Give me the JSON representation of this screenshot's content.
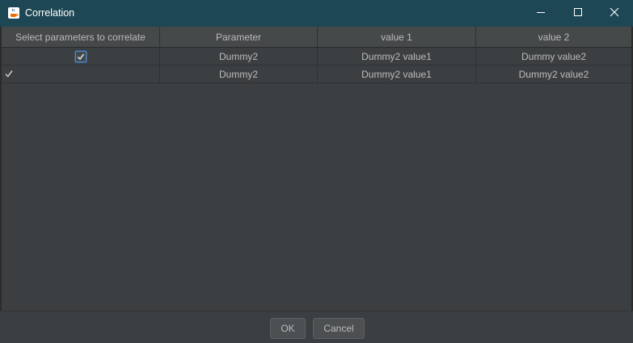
{
  "window": {
    "title": "Correlation",
    "icons": {
      "app": "java-coffee-cup-icon",
      "minimize": "minimize-icon",
      "maximize": "maximize-icon",
      "close": "close-icon"
    }
  },
  "table": {
    "columns": [
      "Select parameters to correlate",
      "Parameter",
      "value 1",
      "value 2"
    ],
    "rows": [
      {
        "selected": true,
        "parameter": "Dummy2",
        "value1": "Dummy2 value1",
        "value2": "Dummy value2"
      },
      {
        "selected": true,
        "parameter": "Dummy2",
        "value1": "Dummy2 value1",
        "value2": "Dummy2 value2"
      }
    ]
  },
  "buttons": {
    "ok": "OK",
    "cancel": "Cancel"
  },
  "colors": {
    "titlebar": "#1e4755",
    "background": "#3c3f41",
    "header": "#45494a",
    "text": "#bbbbbb",
    "focus": "#4a88c7"
  }
}
